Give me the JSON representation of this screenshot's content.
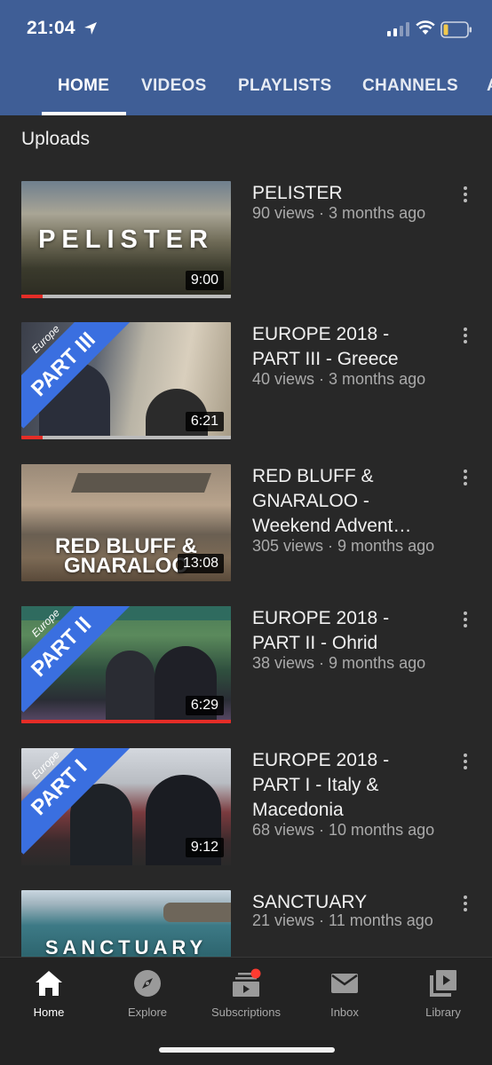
{
  "status": {
    "time": "21:04"
  },
  "tabs": [
    {
      "label": "HOME"
    },
    {
      "label": "VIDEOS"
    },
    {
      "label": "PLAYLISTS"
    },
    {
      "label": "CHANNELS"
    },
    {
      "label": "A"
    }
  ],
  "section_title": "Uploads",
  "videos": [
    {
      "title": "PELISTER",
      "meta": "90 views · 3 months ago",
      "duration": "9:00",
      "thumb_text": "PELISTER",
      "watched_fraction": 0.1
    },
    {
      "title": "EUROPE 2018 -\nPART III - Greece",
      "meta": "40 views · 3 months ago",
      "duration": "6:21",
      "banner_top": "Europe",
      "banner_part": "PART III",
      "watched_fraction": 0.1
    },
    {
      "title": "RED BLUFF &\nGNARALOO -\nWeekend Advent…",
      "meta": "305 views · 9 months ago",
      "duration": "13:08",
      "thumb_text": "RED BLUFF &\nGNARALOO"
    },
    {
      "title": "EUROPE 2018 -\nPART II - Ohrid",
      "meta": "38 views · 9 months ago",
      "duration": "6:29",
      "banner_top": "Europe",
      "banner_part": "PART II",
      "watched_fraction": 1.0
    },
    {
      "title": "EUROPE 2018 -\nPART I - Italy &\nMacedonia",
      "meta": "68 views · 10 months ago",
      "duration": "9:12",
      "banner_top": "Europe",
      "banner_part": "PART I"
    },
    {
      "title": "SANCTUARY",
      "meta": "21 views · 11 months ago",
      "thumb_text": "SANCTUARY"
    }
  ],
  "bottom_nav": [
    {
      "label": "Home",
      "icon": "home-icon",
      "active": true
    },
    {
      "label": "Explore",
      "icon": "compass-icon"
    },
    {
      "label": "Subscriptions",
      "icon": "subscriptions-icon"
    },
    {
      "label": "Inbox",
      "icon": "mail-icon"
    },
    {
      "label": "Library",
      "icon": "library-icon"
    }
  ],
  "colors": {
    "header": "#3f5e96",
    "background": "#282828",
    "progress": "#e52d27",
    "banner": "#3a6fe0"
  }
}
